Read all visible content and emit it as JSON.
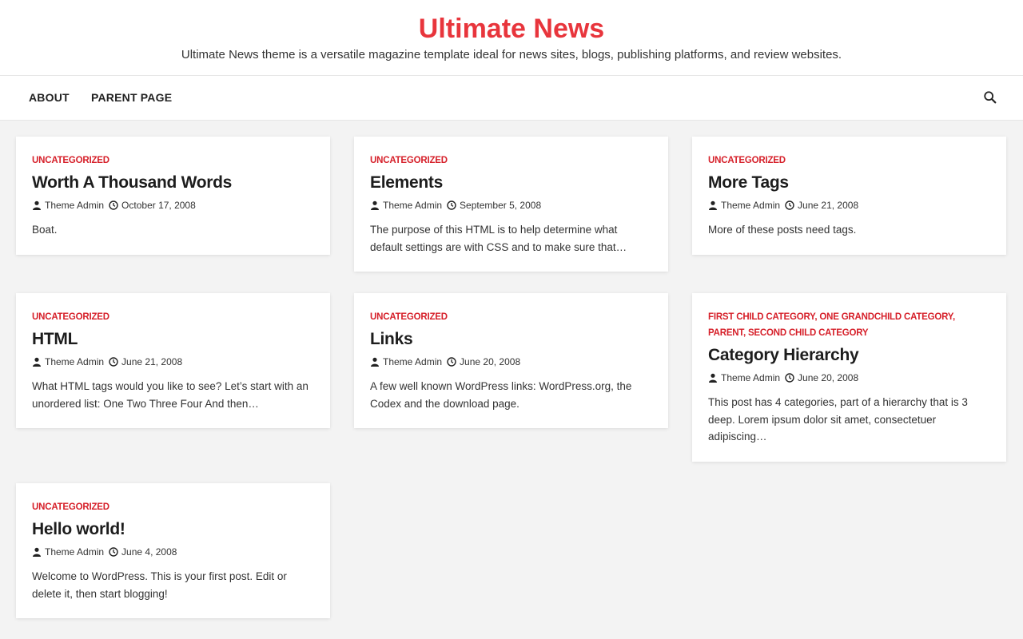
{
  "site": {
    "title": "Ultimate News",
    "description": "Ultimate News theme is a versatile magazine template ideal for news sites, blogs, publishing platforms, and review websites.",
    "accent_color": "#e8353c"
  },
  "nav": {
    "items": [
      {
        "label": "ABOUT"
      },
      {
        "label": "PARENT PAGE"
      }
    ],
    "search_icon": "search-icon"
  },
  "posts": [
    {
      "categories": [
        "UNCATEGORIZED"
      ],
      "title": "Worth A Thousand Words",
      "author": "Theme Admin",
      "date": "October 17, 2008",
      "excerpt": "Boat."
    },
    {
      "categories": [
        "UNCATEGORIZED"
      ],
      "title": "Elements",
      "author": "Theme Admin",
      "date": "September 5, 2008",
      "excerpt": "The purpose of this HTML is to help determine what default settings are with CSS and to make sure that…"
    },
    {
      "categories": [
        "UNCATEGORIZED"
      ],
      "title": "More Tags",
      "author": "Theme Admin",
      "date": "June 21, 2008",
      "excerpt": "More of these posts need tags."
    },
    {
      "categories": [
        "UNCATEGORIZED"
      ],
      "title": "HTML",
      "author": "Theme Admin",
      "date": "June 21, 2008",
      "excerpt": "What HTML tags would you like to see? Let’s start with an unordered list: One Two Three Four And then…"
    },
    {
      "categories": [
        "UNCATEGORIZED"
      ],
      "title": "Links",
      "author": "Theme Admin",
      "date": "June 20, 2008",
      "excerpt": "A few well known WordPress links: WordPress.org, the Codex and the download page."
    },
    {
      "categories": [
        "FIRST CHILD CATEGORY",
        "ONE GRANDCHILD CATEGORY",
        "PARENT",
        "SECOND CHILD CATEGORY"
      ],
      "title": "Category Hierarchy",
      "author": "Theme Admin",
      "date": "June 20, 2008",
      "excerpt": "This post has 4 categories, part of a hierarchy that is 3 deep. Lorem ipsum dolor sit amet, consectetuer adipiscing…"
    },
    {
      "categories": [
        "UNCATEGORIZED"
      ],
      "title": "Hello world!",
      "author": "Theme Admin",
      "date": "June 4, 2008",
      "excerpt": "Welcome to WordPress. This is your first post. Edit or delete it, then start blogging!"
    }
  ]
}
